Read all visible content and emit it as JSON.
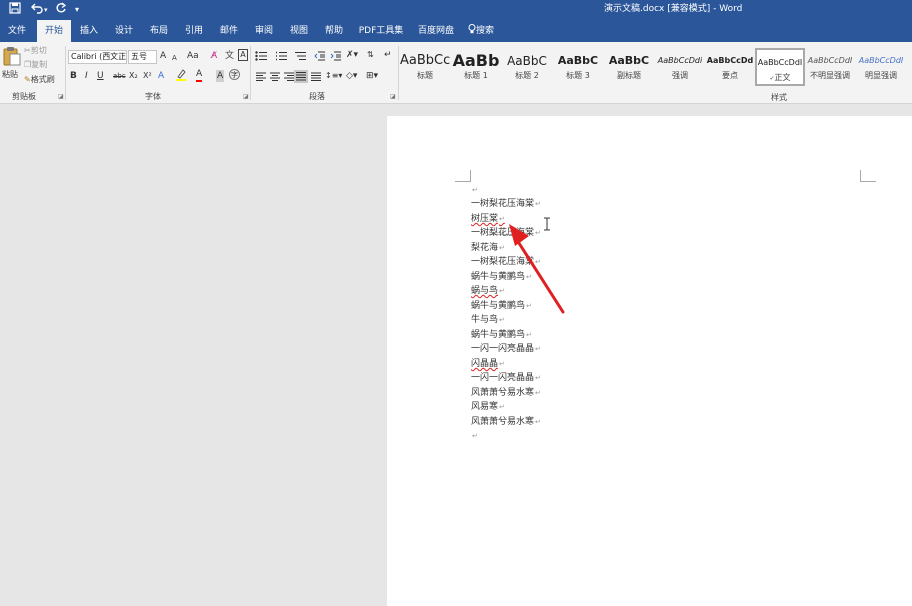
{
  "titlebar": {
    "document_title": "演示文稿.docx [兼容模式] - Word",
    "icons": [
      "save-icon",
      "undo-icon",
      "redo-icon",
      "customize-quick-access-icon"
    ]
  },
  "tabs": [
    {
      "label": "文件",
      "active": false
    },
    {
      "label": "开始",
      "active": true
    },
    {
      "label": "插入",
      "active": false
    },
    {
      "label": "设计",
      "active": false
    },
    {
      "label": "布局",
      "active": false
    },
    {
      "label": "引用",
      "active": false
    },
    {
      "label": "邮件",
      "active": false
    },
    {
      "label": "审阅",
      "active": false
    },
    {
      "label": "视图",
      "active": false
    },
    {
      "label": "帮助",
      "active": false
    },
    {
      "label": "PDF工具集",
      "active": false
    },
    {
      "label": "百度网盘",
      "active": false
    },
    {
      "label": "搜索",
      "active": false
    }
  ],
  "clipboard": {
    "paste": "粘贴",
    "cut": "剪切",
    "copy": "复制",
    "format_painter": "格式刷",
    "group_label": "剪贴板"
  },
  "font": {
    "font_name": "Calibri (西文正文)",
    "font_size": "五号",
    "grow": "A",
    "shrink": "A",
    "change_case": "Aa",
    "bold": "B",
    "italic": "I",
    "underline": "U",
    "strike": "abc",
    "subscript": "X₂",
    "superscript": "X²",
    "text_effects": "A",
    "font_color": "A",
    "char_shading": "A",
    "group_label": "字体"
  },
  "paragraph": {
    "group_label": "段落"
  },
  "styles": {
    "items": [
      {
        "preview": "AaBbCc",
        "name": "标题",
        "size": "13px",
        "weight": "normal",
        "style": "normal",
        "color": "#222222"
      },
      {
        "preview": "AaBb",
        "name": "标题 1",
        "size": "17px",
        "weight": "bold",
        "style": "normal",
        "color": "#111111"
      },
      {
        "preview": "AaBbC",
        "name": "标题 2",
        "size": "13px",
        "weight": "normal",
        "style": "normal",
        "color": "#222222"
      },
      {
        "preview": "AaBbC",
        "name": "标题 3",
        "size": "12px",
        "weight": "bold",
        "style": "normal",
        "color": "#222222"
      },
      {
        "preview": "AaBbC",
        "name": "副标题",
        "size": "12px",
        "weight": "bold",
        "style": "normal",
        "color": "#222222"
      },
      {
        "preview": "AaBbCcDdi",
        "name": "强调",
        "size": "8px",
        "weight": "normal",
        "style": "italic",
        "color": "#333333"
      },
      {
        "preview": "AaBbCcDd",
        "name": "要点",
        "size": "8px",
        "weight": "bold",
        "style": "normal",
        "color": "#222222"
      },
      {
        "preview": "AaBbCcDdI",
        "name": "正文",
        "size": "8px",
        "weight": "normal",
        "style": "normal",
        "color": "#222222"
      },
      {
        "preview": "AaBbCcDdI",
        "name": "不明显强调",
        "size": "8px",
        "weight": "normal",
        "style": "italic",
        "color": "#555555"
      },
      {
        "preview": "AaBbCcDdI",
        "name": "明显强调",
        "size": "8px",
        "weight": "normal",
        "style": "italic",
        "color": "#4472c4"
      }
    ],
    "selected_index": 7,
    "group_label": "样式"
  },
  "document": {
    "lines": [
      {
        "text": ""
      },
      {
        "text": "一树梨花压海棠"
      },
      {
        "text": "树压棠"
      },
      {
        "text": "一树梨花压海棠"
      },
      {
        "text": "梨花海"
      },
      {
        "text": "一树梨花压海棠"
      },
      {
        "text": "蜗牛与黄鹂鸟"
      },
      {
        "text": "蜗与鸟"
      },
      {
        "text": "蜗牛与黄鹂鸟"
      },
      {
        "text": "牛与鸟"
      },
      {
        "text": "蜗牛与黄鹂鸟"
      },
      {
        "text": "一闪一闪亮晶晶"
      },
      {
        "text": "闪晶晶"
      },
      {
        "text": "一闪一闪亮晶晶"
      },
      {
        "text": "风萧萧兮易水寒"
      },
      {
        "text": "风易寒"
      },
      {
        "text": "风萧萧兮易水寒"
      },
      {
        "text": ""
      }
    ],
    "paragraph_mark": "↵"
  },
  "colors": {
    "brand": "#2b579a",
    "arrow": "#e02020",
    "font_color_bar": "#ff0000",
    "highlight_bar": "#ffff00"
  }
}
